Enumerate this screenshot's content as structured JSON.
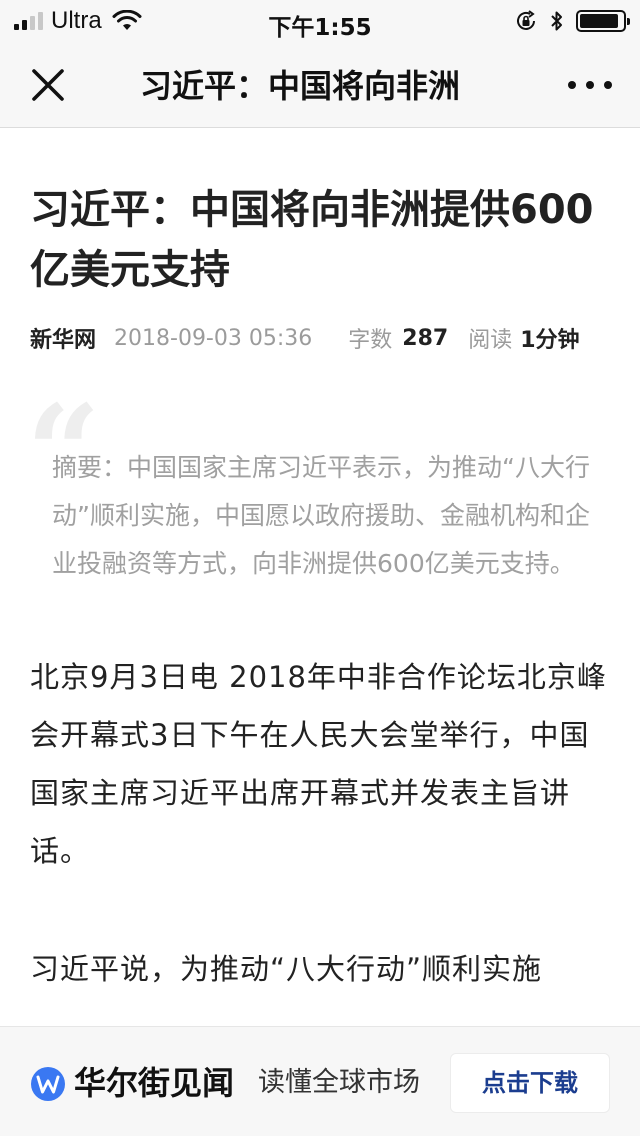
{
  "status_bar": {
    "carrier": "Ultra",
    "time": "下午1:55",
    "battery_level": 0.9
  },
  "nav": {
    "title": "习近平：中国将向非洲"
  },
  "article": {
    "title": "习近平：中国将向非洲提供600亿美元支持",
    "meta": {
      "source": "新华网",
      "date": "2018-09-03 05:36",
      "word_count_label": "字数",
      "word_count": "287",
      "read_time_label": "阅读",
      "read_time": "1分钟"
    },
    "summary": "摘要：中国国家主席习近平表示，为推动“八大行动”顺利实施，中国愿以政府援助、金融机构和企业投融资等方式，向非洲提供600亿美元支持。",
    "paragraphs": [
      "北京9月3日电 2018年中非合作论坛北京峰会开幕式3日下午在人民大会堂举行，中国国家主席习近平出席开幕式并发表主旨讲话。",
      "习近平说，为推动“八大行动”顺利实施"
    ]
  },
  "banner": {
    "brand": "华尔街见闻",
    "slogan": "读懂全球市场",
    "download_label": "点击下载",
    "accent_color": "#1b3d8f",
    "logo_color": "#3a78f2"
  },
  "icons": {
    "close": "close-icon",
    "more": "more-icon",
    "wifi": "wifi-icon",
    "bluetooth": "bluetooth-icon",
    "rotation_lock": "rotation-lock-icon",
    "battery": "battery-icon",
    "quote": "quote-icon",
    "brand_logo": "wallstreetcn-logo-icon"
  }
}
